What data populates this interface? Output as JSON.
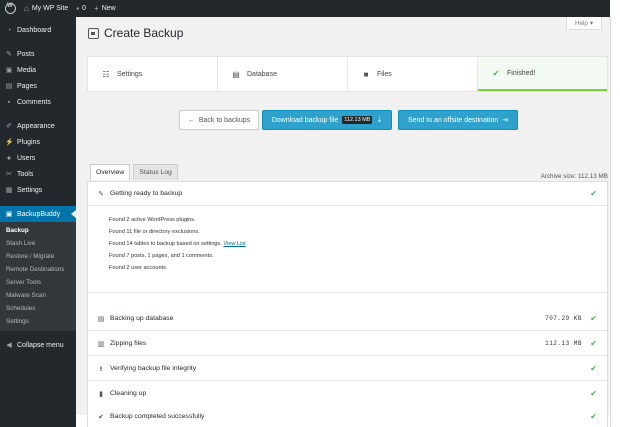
{
  "adminbar": {
    "site_name": "My WP Site",
    "comments_count": "0",
    "new_label": "New",
    "icons": {
      "wp": "wordpress-logo-icon",
      "home": "home-icon",
      "comment": "comment-icon",
      "plus": "plus-icon"
    }
  },
  "sidebar": {
    "items": [
      {
        "label": "Dashboard",
        "icon": "dashboard-icon"
      },
      {
        "label": "Posts",
        "icon": "pin-icon"
      },
      {
        "label": "Media",
        "icon": "media-icon"
      },
      {
        "label": "Pages",
        "icon": "pages-icon"
      },
      {
        "label": "Comments",
        "icon": "comment-icon"
      },
      {
        "label": "Appearance",
        "icon": "brush-icon"
      },
      {
        "label": "Plugins",
        "icon": "plug-icon"
      },
      {
        "label": "Users",
        "icon": "users-icon"
      },
      {
        "label": "Tools",
        "icon": "wrench-icon"
      },
      {
        "label": "Settings",
        "icon": "settings-icon"
      },
      {
        "label": "BackupBuddy",
        "icon": "backupbuddy-icon"
      }
    ],
    "submenu": [
      "Backup",
      "Stash Live",
      "Restore / Migrate",
      "Remote Destinations",
      "Server Tools",
      "Malware Scan",
      "Schedules",
      "Settings"
    ],
    "collapse_label": "Collapse menu"
  },
  "help_label": "Help",
  "page_title": "Create Backup",
  "steps": [
    {
      "label": "Settings",
      "icon": "sliders-icon"
    },
    {
      "label": "Database",
      "icon": "database-icon"
    },
    {
      "label": "Files",
      "icon": "folder-icon"
    },
    {
      "label": "Finished!",
      "icon": "check-icon"
    }
  ],
  "actions": {
    "back_label": "Back to backups",
    "download_label": "Download backup file",
    "download_size": "112.13 MB",
    "send_label": "Send to an offsite destination"
  },
  "tabs": [
    "Overview",
    "Status Log"
  ],
  "archive_size": "Archive size:  112.13 MB",
  "rows": [
    {
      "label": "Getting ready to backup",
      "icon": "wrench-icon",
      "size": ""
    },
    {
      "label": "Backing up database",
      "icon": "database-icon",
      "size": "707.29 KB"
    },
    {
      "label": "Zipping files",
      "icon": "zip-icon",
      "size": "112.13 MB"
    },
    {
      "label": "Verifying backup file integrity",
      "icon": "verify-icon",
      "size": ""
    },
    {
      "label": "Cleaning up",
      "icon": "trash-icon",
      "size": ""
    },
    {
      "label": "Backup completed successfully",
      "icon": "check-icon",
      "size": ""
    }
  ],
  "details": {
    "line1": "Found 2 active WordPress plugins.",
    "line2": "Found 11 file or directory exclusions.",
    "line3_prefix": "Found 14 tables to backup based on settings.",
    "line3_link": "View List",
    "line4": "Found 7 posts, 1 pages, and 1 comments.",
    "line5": "Found 2 user accounts."
  }
}
